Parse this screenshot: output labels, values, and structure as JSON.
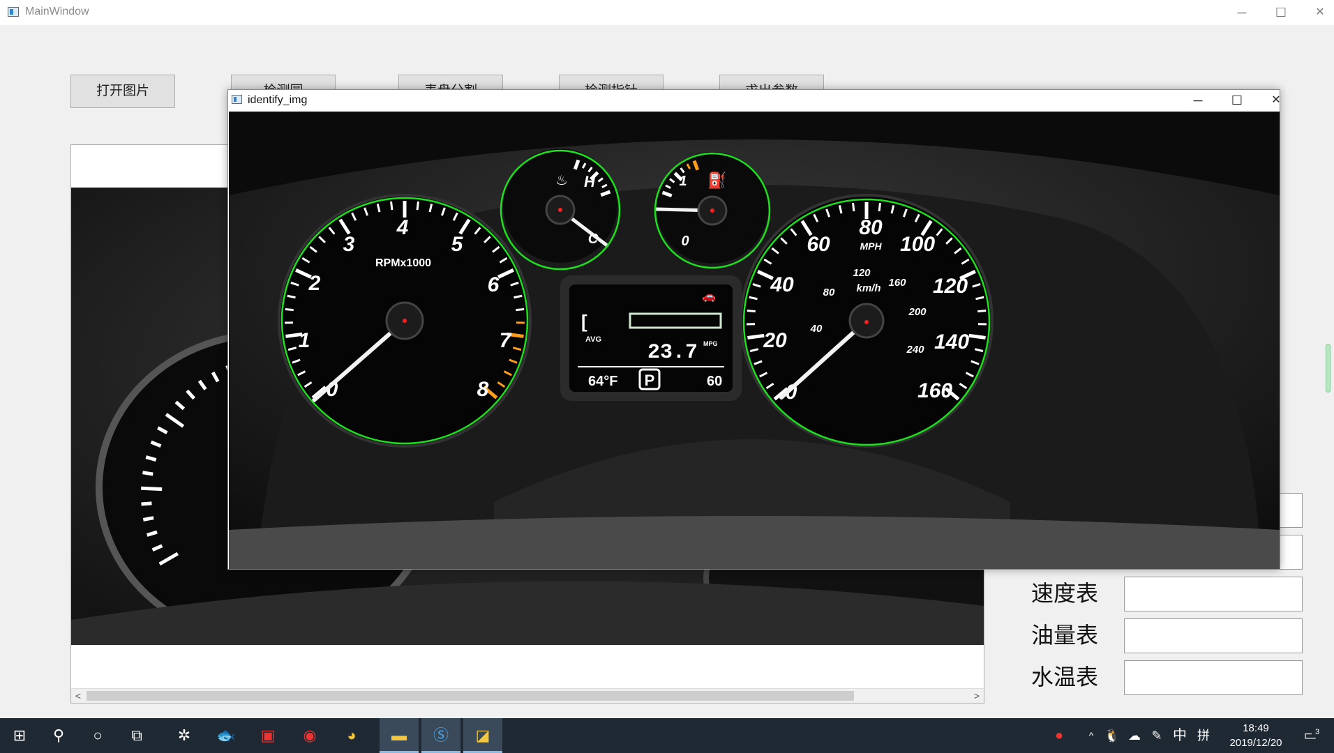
{
  "window": {
    "title": "MainWindow",
    "minimize": "─",
    "maximize": "☐",
    "close": "✕"
  },
  "toolbar": {
    "open_label": "打开图片",
    "b2_label": "检测圆",
    "b3_label": "表盘分割",
    "b4_label": "检测指针",
    "b5_label": "求出参数"
  },
  "params": {
    "speed_label": "速度表",
    "fuel_label": "油量表",
    "water_label": "水温表"
  },
  "viewer": {
    "scroll_left": "<",
    "scroll_right": ">"
  },
  "popup": {
    "title": "identify_img",
    "minimize": "─",
    "maximize": "☐",
    "close": "✕"
  },
  "dashboard": {
    "tach_unit": "RPMx1000",
    "tach_ticks": [
      "0",
      "1",
      "2",
      "3",
      "4",
      "5",
      "6",
      "7",
      "8"
    ],
    "speed_mph_ticks": [
      "0",
      "20",
      "40",
      "60",
      "80",
      "100",
      "120",
      "140",
      "160"
    ],
    "speed_kmh_ticks": [
      "40",
      "80",
      "120",
      "160",
      "200",
      "240"
    ],
    "speed_unit_mph": "MPH",
    "speed_unit_kmh": "km/h",
    "temp_high": "H",
    "temp_low": "C",
    "fuel_full": "1",
    "fuel_empty": "0",
    "lcd_avg": "AVG",
    "lcd_mpg": "23.7",
    "lcd_mpg_unit": "MPG",
    "lcd_temp": "64°F",
    "lcd_gear": "P",
    "lcd_right": "60",
    "lcd_bracket": "["
  },
  "taskbar": {
    "start_icon": "windows-start-icon",
    "time": "18:49",
    "date": "2019/12/20",
    "ime_lang": "中",
    "ime_mode": "拼",
    "notif_count": "3"
  },
  "colors": {
    "circle": "#1fe01f",
    "center_dot": "#ff2020",
    "orange": "#ff9c1a",
    "taskbar": "#1f2933"
  }
}
